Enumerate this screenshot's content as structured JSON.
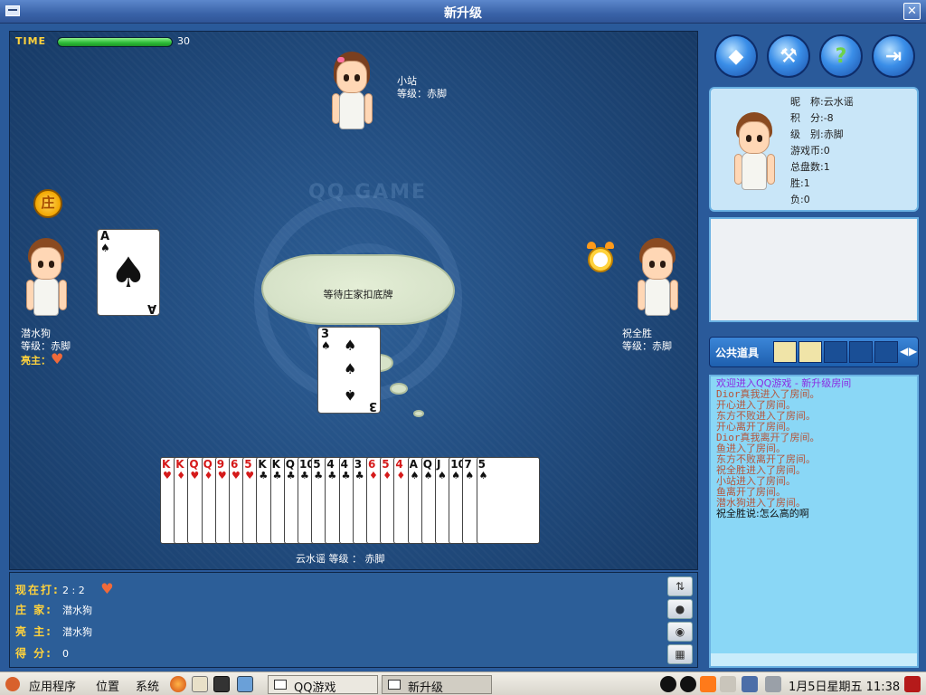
{
  "window": {
    "title": "新升级"
  },
  "timer": {
    "label": "TIME",
    "value": "30",
    "progress": 1.0
  },
  "table": {
    "logo_text": "QQ GAME",
    "top_player": {
      "name": "小站",
      "level": "等级：赤脚"
    },
    "left_player": {
      "name": "潜水狗",
      "level": "等级：赤脚",
      "declare_label": "亮主："
    },
    "right_player": {
      "name": "祝全胜",
      "level": "等级：赤脚"
    },
    "banker_badge": "庄",
    "bubble_text": "等待庄家扣底牌",
    "left_played_card": {
      "rank": "A",
      "suit": "♠"
    },
    "center_played_card": {
      "rank": "3",
      "suit": "♠"
    },
    "self_info": "云水谣  等级 ： 赤脚",
    "hand": [
      {
        "r": "K",
        "s": "♥",
        "color": "red"
      },
      {
        "r": "K",
        "s": "♦",
        "color": "red"
      },
      {
        "r": "Q",
        "s": "♥",
        "color": "red"
      },
      {
        "r": "Q",
        "s": "♦",
        "color": "red"
      },
      {
        "r": "9",
        "s": "♥",
        "color": "red"
      },
      {
        "r": "6",
        "s": "♥",
        "color": "red"
      },
      {
        "r": "5",
        "s": "♥",
        "color": "red"
      },
      {
        "r": "K",
        "s": "♣",
        "color": "blk"
      },
      {
        "r": "K",
        "s": "♣",
        "color": "blk"
      },
      {
        "r": "Q",
        "s": "♣",
        "color": "blk"
      },
      {
        "r": "10",
        "s": "♣",
        "color": "blk"
      },
      {
        "r": "5",
        "s": "♣",
        "color": "blk"
      },
      {
        "r": "4",
        "s": "♣",
        "color": "blk"
      },
      {
        "r": "4",
        "s": "♣",
        "color": "blk"
      },
      {
        "r": "3",
        "s": "♣",
        "color": "blk"
      },
      {
        "r": "6",
        "s": "♦",
        "color": "red"
      },
      {
        "r": "5",
        "s": "♦",
        "color": "red"
      },
      {
        "r": "4",
        "s": "♦",
        "color": "red"
      },
      {
        "r": "A",
        "s": "♠",
        "color": "blk"
      },
      {
        "r": "Q",
        "s": "♠",
        "color": "blk"
      },
      {
        "r": "J",
        "s": "♠",
        "color": "blk"
      },
      {
        "r": "10",
        "s": "♠",
        "color": "blk"
      },
      {
        "r": "7",
        "s": "♠",
        "color": "blk"
      },
      {
        "r": "5",
        "s": "♠",
        "color": "blk"
      }
    ]
  },
  "status": {
    "playing_label": "现在打:",
    "playing_value": "2 : 2",
    "banker_label": "庄  家:",
    "banker_value": "潜水狗",
    "declare_label": "亮  主:",
    "declare_value": "潜水狗",
    "score_label": "得  分:",
    "score_value": "0"
  },
  "profile": {
    "nickname": "昵　称:云水谣",
    "points": "积　分:-8",
    "rank": "级　别:赤脚",
    "coins": "游戏币:0",
    "total_games": "总盘数:1",
    "wins": "胜:1",
    "losses": "负:0"
  },
  "items_bar": {
    "label": "公共道具"
  },
  "chat": {
    "welcome": "欢迎进入QQ游戏 - 新升级房间",
    "lines": [
      "Dior真我进入了房间。",
      "开心进入了房间。",
      "东方不败进入了房间。",
      "开心离开了房间。",
      "Dior真我离开了房间。",
      "鱼进入了房间。",
      "东方不败离开了房间。",
      "祝全胜进入了房间。",
      "小站进入了房间。",
      "鱼离开了房间。",
      "潜水狗进入了房间。"
    ],
    "say": "祝全胜说:怎么高的啊"
  },
  "taskbar": {
    "apps_menu": "应用程序",
    "places_menu": "位置",
    "system_menu": "系统",
    "window1": "QQ游戏",
    "window2": "新升级",
    "clock": "1月5日星期五 11:38"
  },
  "colors": {
    "table": "#224d80",
    "chat_bg": "#8ad7f6",
    "accent_gold": "#ffd23c"
  }
}
